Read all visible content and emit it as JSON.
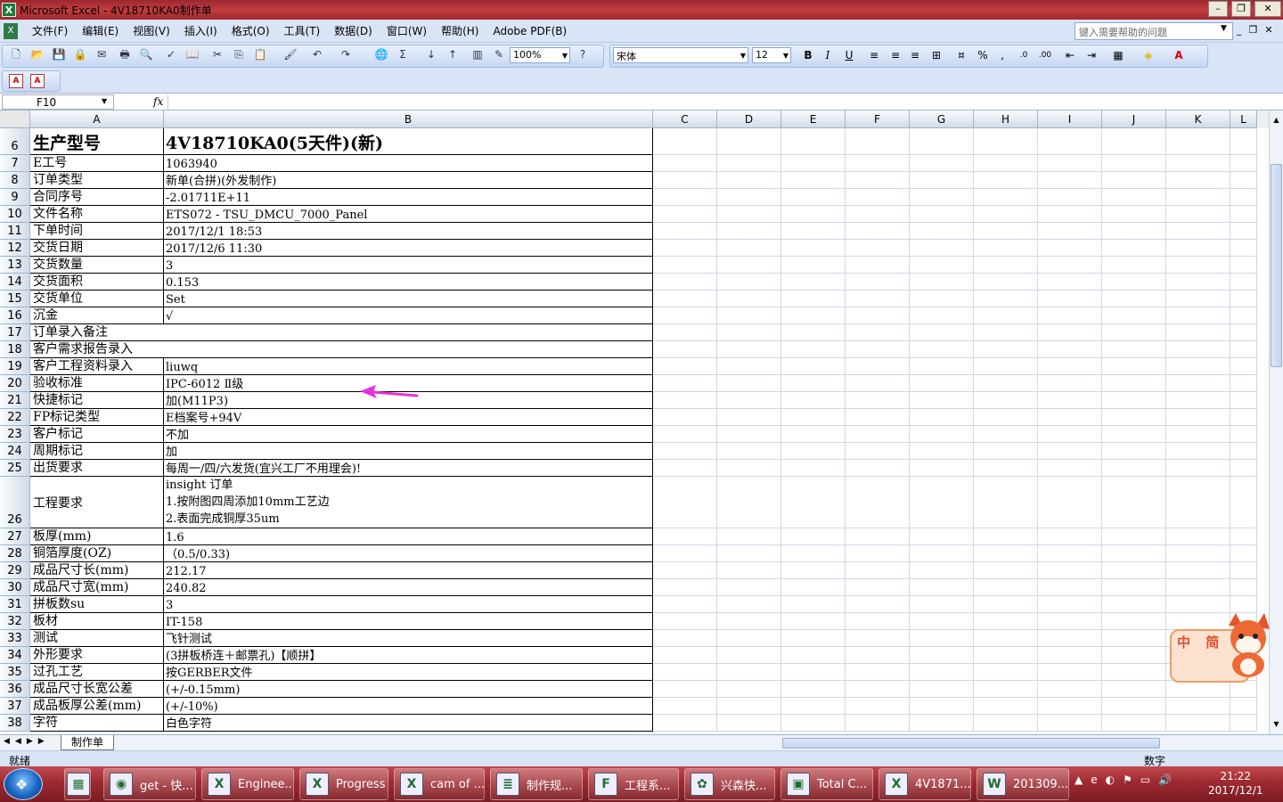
{
  "window": {
    "title": "Microsoft Excel - 4V18710KA0制作单"
  },
  "menubar": {
    "items": [
      "文件(F)",
      "编辑(E)",
      "视图(V)",
      "插入(I)",
      "格式(O)",
      "工具(T)",
      "数据(D)",
      "窗口(W)",
      "帮助(H)",
      "Adobe PDF(B)"
    ],
    "help_placeholder": "键入需要帮助的问题"
  },
  "toolbar": {
    "zoom": "100%",
    "font": "宋体",
    "font_size": "12",
    "bold": "B",
    "italic": "I",
    "underline": "U",
    "percent": "%",
    "comma": ","
  },
  "formula_bar": {
    "cell_ref": "F10",
    "fx": "fx",
    "value": ""
  },
  "columns": [
    "A",
    "B",
    "C",
    "D",
    "E",
    "F",
    "G",
    "H",
    "I",
    "J",
    "K",
    "L"
  ],
  "rows": [
    {
      "num": "6",
      "a": "生产型号",
      "b": "4V18710KA0(5天件)(新)"
    },
    {
      "num": "7",
      "a": "E工号",
      "b": "1063940"
    },
    {
      "num": "8",
      "a": "订单类型",
      "b": "新单(合拼)(外发制作)"
    },
    {
      "num": "9",
      "a": "合同序号",
      "b": "-2.01711E+11"
    },
    {
      "num": "10",
      "a": "文件名称",
      "b": "ETS072 - TSU_DMCU_7000_Panel"
    },
    {
      "num": "11",
      "a": "下单时间",
      "b": "2017/12/1 18:53"
    },
    {
      "num": "12",
      "a": "交货日期",
      "b": "2017/12/6 11:30"
    },
    {
      "num": "13",
      "a": "交货数量",
      "b": "3"
    },
    {
      "num": "14",
      "a": "交货面积",
      "b": "0.153"
    },
    {
      "num": "15",
      "a": "交货单位",
      "b": "Set"
    },
    {
      "num": "16",
      "a": "沉金",
      "b": "√"
    },
    {
      "num": "17",
      "a": "订单录入备注",
      "b": ""
    },
    {
      "num": "18",
      "a": "客户需求报告录入",
      "b": ""
    },
    {
      "num": "19",
      "a": "客户工程资料录入",
      "b": "liuwq"
    },
    {
      "num": "20",
      "a": "验收标准",
      "b": "IPC-6012 Ⅱ级"
    },
    {
      "num": "21",
      "a": "快捷标记",
      "b": "加(M11P3)"
    },
    {
      "num": "22",
      "a": "FP标记类型",
      "b": "E档案号+94V"
    },
    {
      "num": "23",
      "a": "客户标记",
      "b": "不加"
    },
    {
      "num": "24",
      "a": "周期标记",
      "b": "加"
    },
    {
      "num": "25",
      "a": "出货要求",
      "b": "每周一/四/六发货(宜兴工厂不用理会)!"
    },
    {
      "num": "26",
      "a": "工程要求",
      "b_lines": [
        "insight 订单",
        "1.按附图四周添加10mm工艺边",
        "2.表面完成铜厚35um"
      ]
    },
    {
      "num": "27",
      "a": "板厚(mm)",
      "b": "1.6"
    },
    {
      "num": "28",
      "a": "铜箔厚度(OZ)",
      "b": "（0.5/0.33)"
    },
    {
      "num": "29",
      "a": "成品尺寸长(mm)",
      "b": "212.17"
    },
    {
      "num": "30",
      "a": "成品尺寸宽(mm)",
      "b": "240.82"
    },
    {
      "num": "31",
      "a": "拼板数su",
      "b": "3"
    },
    {
      "num": "32",
      "a": "板材",
      "b": "IT-158"
    },
    {
      "num": "33",
      "a": "测试",
      "b": "飞针测试"
    },
    {
      "num": "34",
      "a": "外形要求",
      "b": "(3拼板桥连＋邮票孔)【顺拼】"
    },
    {
      "num": "35",
      "a": "过孔工艺",
      "b": "按GERBER文件"
    },
    {
      "num": "36",
      "a": "成品尺寸长宽公差",
      "b": "(+/-0.15mm)"
    },
    {
      "num": "37",
      "a": "成品板厚公差(mm)",
      "b": "(+/-10%)"
    },
    {
      "num": "38",
      "a": "字符",
      "b": "白色字符"
    }
  ],
  "sheet_tabs": [
    "制作单"
  ],
  "status": {
    "left": "就绪",
    "num": "数字"
  },
  "taskbar": {
    "tasks": [
      "get - 快...",
      "Enginee...",
      "Progress",
      "cam of ...",
      "制作规...",
      "工程系...",
      "兴森快...",
      "Total C...",
      "4V1871...",
      "201309..."
    ],
    "time": "21:22",
    "date": "2017/12/1"
  },
  "ime": {
    "label": "中 简"
  },
  "colors": {
    "titlebar": "#b23139",
    "arrow": "#e633d8",
    "menubar": "#d9e4f6",
    "taskbar": "#9d2a31"
  }
}
